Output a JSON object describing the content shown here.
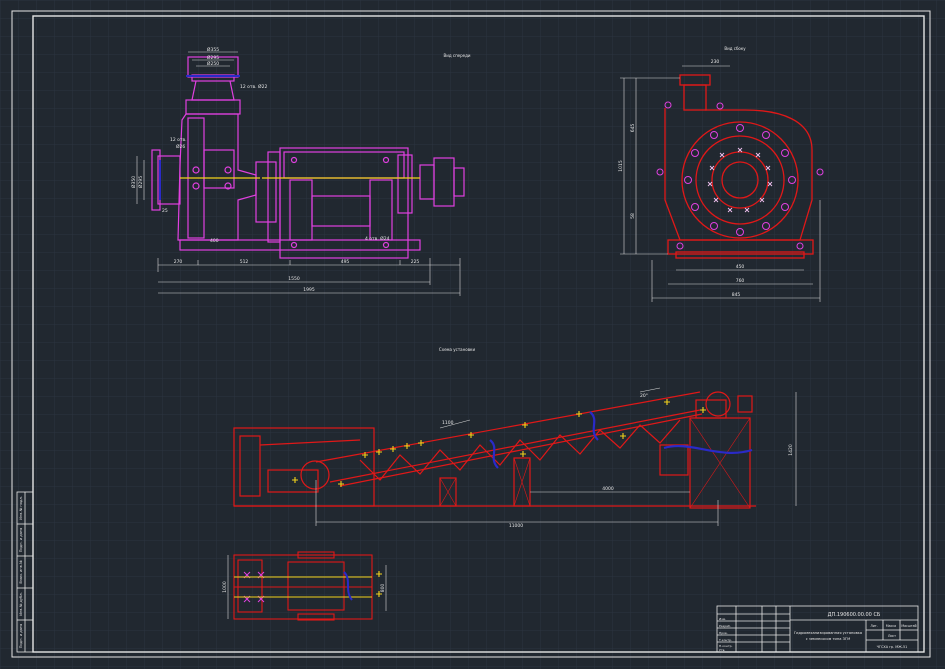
{
  "colors": {
    "background": "#212830",
    "grid": "#2c3440",
    "frame": "#e6e6e6",
    "dimension": "#d8d8d8",
    "pump_outline": "#e040e0",
    "red_outline": "#e01818",
    "yellow_marker": "#f2d21a",
    "blue_detail": "#2a2ac8",
    "white_marker": "#ffffff"
  },
  "views": {
    "front_view_title": "Вид спереди",
    "side_view_title": "Вид сбоку",
    "conveyor_title": "Схема установки"
  },
  "pump_front": {
    "flange_dims": [
      "Ø355",
      "Ø295",
      "Ø250"
    ],
    "hole_note_top": "12 отв. Ø22",
    "hole_note_side": "12 отв.",
    "hole_note_side_size": "Ø26",
    "left_dims": [
      "Ø350",
      "Ø295"
    ],
    "left_small": "25",
    "bottom_small": "400",
    "hole_note_base": "4 отв. Ø24",
    "chain_dims": [
      "270",
      "512",
      "495",
      "225"
    ],
    "overall_dim_1": "1550",
    "overall_dim_2": "1995"
  },
  "pump_side": {
    "top_dim": "230",
    "left_dim_upper": "645",
    "left_dim_lower": "58",
    "left_dim_total": "1015",
    "bottom_dim_inner": "450",
    "bottom_dim_mid": "760",
    "bottom_dim_outer": "845"
  },
  "conveyor": {
    "angle_label": "20°",
    "span_label": "1100",
    "height_label": "1420",
    "lower_dim": "4000",
    "base_dim": "11000"
  },
  "plan": {
    "left_dim": "1000",
    "right_dim": "800"
  },
  "title_block": {
    "designation": "ДП.190600.00.00 СБ",
    "description_line1": "Гидромеханизированная установка",
    "description_line2": "с землесосом типа ЗГМ",
    "col_headers": [
      "Лит.",
      "Масса",
      "Масштаб"
    ],
    "sheet_label": "Лист",
    "org_label": "ЧГСХА гр. МЖ-51",
    "rows": [
      "Изм.",
      "Разраб.",
      "Пров.",
      "Т.контр.",
      "Н.контр.",
      "Утв."
    ]
  },
  "side_stamp": {
    "cells": [
      "Инв.№ подл.",
      "Подп. и дата",
      "Взам. инв.№",
      "Инв.№ дубл.",
      "Подп. и дата"
    ]
  }
}
